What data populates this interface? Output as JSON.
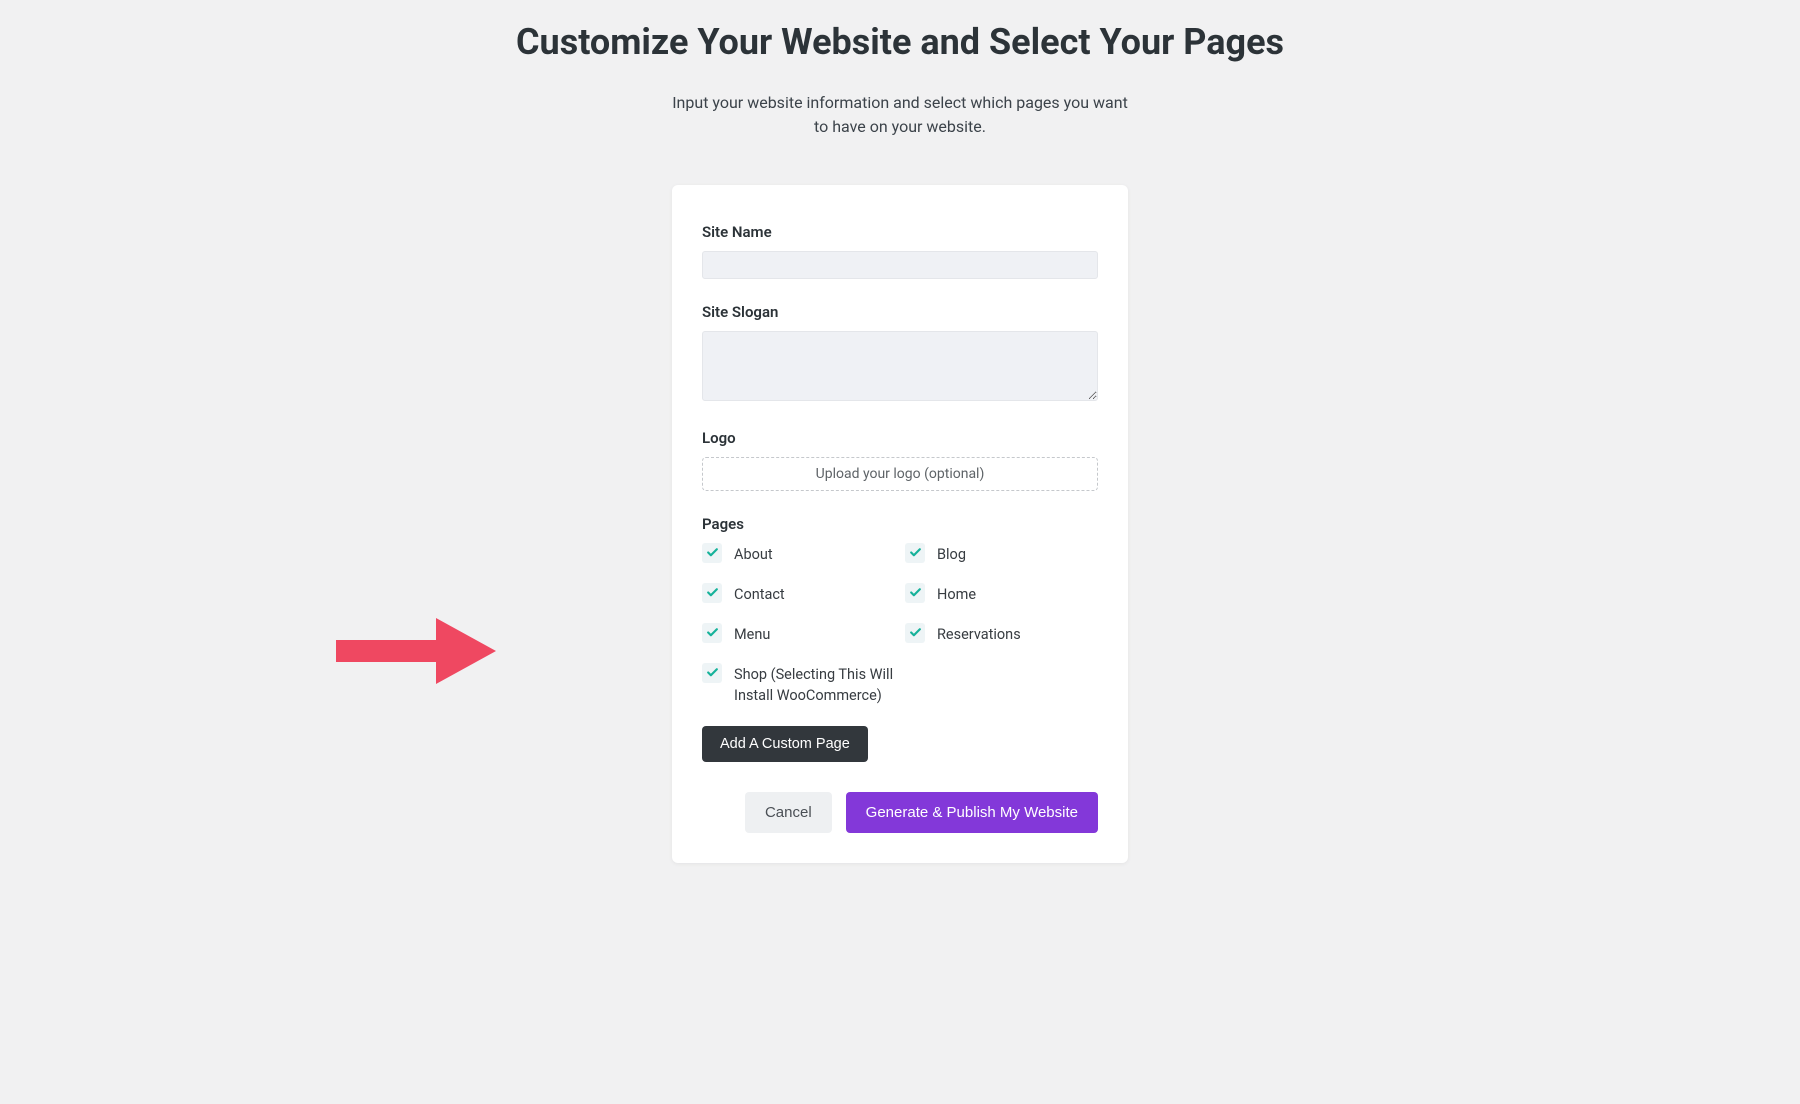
{
  "header": {
    "title": "Customize Your Website and Select Your Pages",
    "subtitle": "Input your website information and select which pages you want to have on your website."
  },
  "form": {
    "siteName": {
      "label": "Site Name",
      "value": ""
    },
    "siteSlogan": {
      "label": "Site Slogan",
      "value": ""
    },
    "logo": {
      "label": "Logo",
      "uploadText": "Upload your logo (optional)"
    },
    "pagesLabel": "Pages",
    "pages": [
      {
        "label": "About",
        "checked": true
      },
      {
        "label": "Blog",
        "checked": true
      },
      {
        "label": "Contact",
        "checked": true
      },
      {
        "label": "Home",
        "checked": true
      },
      {
        "label": "Menu",
        "checked": true
      },
      {
        "label": "Reservations",
        "checked": true
      },
      {
        "label": "Shop (Selecting This Will Install WooCommerce)",
        "checked": true
      }
    ],
    "addCustomLabel": "Add A Custom Page"
  },
  "actions": {
    "cancel": "Cancel",
    "generate": "Generate & Publish My Website"
  },
  "colors": {
    "accent": "#8338d9",
    "check": "#16b29a",
    "arrow": "#ef4861"
  }
}
